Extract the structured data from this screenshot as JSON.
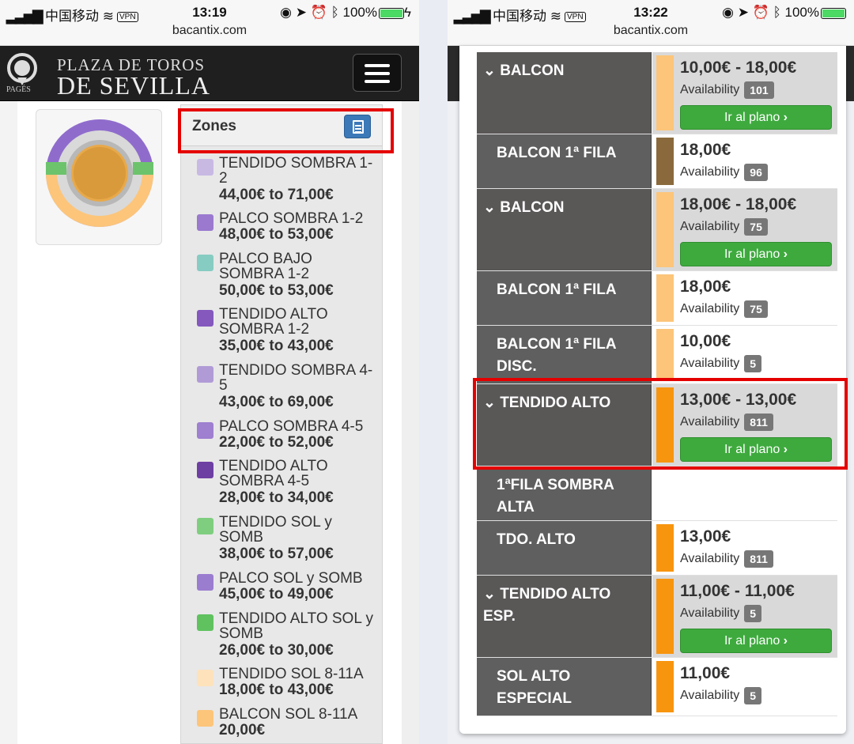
{
  "left": {
    "status": {
      "carrier": "中国移动",
      "vpn": "VPN",
      "time": "13:19",
      "battery": "100%",
      "url": "bacantix.com"
    },
    "nav": {
      "title1": "PLAZA DE TOROS",
      "title2": "DE SEVILLA",
      "brand": "PAGÉS"
    },
    "zones_title": "Zones",
    "zones": [
      {
        "name": "TENDIDO SOMBRA 1-2",
        "price": "44,00€ to 71,00€",
        "color": "#c8b9e3"
      },
      {
        "name": "PALCO SOMBRA 1-2",
        "price": "48,00€ to 53,00€",
        "color": "#9b79cf"
      },
      {
        "name": "PALCO BAJO SOMBRA 1-2",
        "price": "50,00€ to 53,00€",
        "color": "#86ccc2"
      },
      {
        "name": "TENDIDO ALTO SOMBRA 1-2",
        "price": "35,00€ to 43,00€",
        "color": "#8458bd"
      },
      {
        "name": "TENDIDO SOMBRA 4-5",
        "price": "43,00€ to 69,00€",
        "color": "#b09bd6"
      },
      {
        "name": "PALCO SOMBRA 4-5",
        "price": "22,00€ to 52,00€",
        "color": "#9e7fd0"
      },
      {
        "name": "TENDIDO ALTO SOMBRA 4-5",
        "price": "28,00€ to 34,00€",
        "color": "#6e3fa3"
      },
      {
        "name": "TENDIDO SOL y SOMB",
        "price": "38,00€ to 57,00€",
        "color": "#7fce7f"
      },
      {
        "name": "PALCO SOL y SOMB",
        "price": "45,00€ to 49,00€",
        "color": "#9b7dcf"
      },
      {
        "name": "TENDIDO ALTO SOL y SOMB",
        "price": "26,00€ to 30,00€",
        "color": "#5fc25f"
      },
      {
        "name": "TENDIDO SOL 8-11A",
        "price": "18,00€ to 43,00€",
        "color": "#fde2bc"
      },
      {
        "name": "BALCON SOL 8-11A",
        "price": "20,00€",
        "color": "#fcc57a"
      }
    ]
  },
  "right": {
    "status": {
      "carrier": "中国移动",
      "vpn": "VPN",
      "time": "13:22",
      "battery": "100%",
      "url": "bacantix.com"
    },
    "availability_label": "Availability",
    "button_label": "Ir al plano",
    "rows": [
      {
        "name": "BALCON",
        "group": true,
        "price": "10,00€ - 18,00€",
        "avail": "101",
        "color": "#fcc57a"
      },
      {
        "name": "BALCON 1ª FILA",
        "group": false,
        "price": "18,00€",
        "avail": "96",
        "color": "#8a6a3c"
      },
      {
        "name": "BALCON",
        "group": true,
        "price": "18,00€ - 18,00€",
        "avail": "75",
        "color": "#fcc57a"
      },
      {
        "name": "BALCON 1ª FILA",
        "group": false,
        "price": "18,00€",
        "avail": "75",
        "color": "#fcc57a"
      },
      {
        "name": "BALCON 1ª FILA DISC.",
        "group": false,
        "price": "10,00€",
        "avail": "5",
        "color": "#fcc57a"
      },
      {
        "name": "TENDIDO ALTO",
        "group": true,
        "price": "13,00€ - 13,00€",
        "avail": "811",
        "color": "#f7950f"
      },
      {
        "name": "1ªFILA SOMBRA ALTA",
        "group": false,
        "price": "",
        "avail": "",
        "color": ""
      },
      {
        "name": "TDO. ALTO",
        "group": false,
        "price": "13,00€",
        "avail": "811",
        "color": "#f7950f"
      },
      {
        "name": "TENDIDO ALTO ESP.",
        "group": true,
        "price": "11,00€ - 11,00€",
        "avail": "5",
        "color": "#f7950f"
      },
      {
        "name": "SOL ALTO ESPECIAL",
        "group": false,
        "price": "11,00€",
        "avail": "5",
        "color": "#f7950f"
      }
    ]
  }
}
